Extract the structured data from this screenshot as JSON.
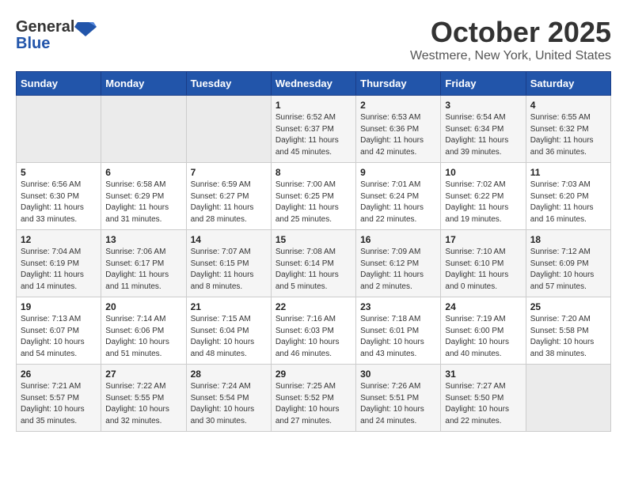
{
  "header": {
    "logo_line1": "General",
    "logo_line2": "Blue",
    "month": "October 2025",
    "location": "Westmere, New York, United States"
  },
  "weekdays": [
    "Sunday",
    "Monday",
    "Tuesday",
    "Wednesday",
    "Thursday",
    "Friday",
    "Saturday"
  ],
  "weeks": [
    [
      {
        "day": "",
        "info": ""
      },
      {
        "day": "",
        "info": ""
      },
      {
        "day": "",
        "info": ""
      },
      {
        "day": "1",
        "info": "Sunrise: 6:52 AM\nSunset: 6:37 PM\nDaylight: 11 hours\nand 45 minutes."
      },
      {
        "day": "2",
        "info": "Sunrise: 6:53 AM\nSunset: 6:36 PM\nDaylight: 11 hours\nand 42 minutes."
      },
      {
        "day": "3",
        "info": "Sunrise: 6:54 AM\nSunset: 6:34 PM\nDaylight: 11 hours\nand 39 minutes."
      },
      {
        "day": "4",
        "info": "Sunrise: 6:55 AM\nSunset: 6:32 PM\nDaylight: 11 hours\nand 36 minutes."
      }
    ],
    [
      {
        "day": "5",
        "info": "Sunrise: 6:56 AM\nSunset: 6:30 PM\nDaylight: 11 hours\nand 33 minutes."
      },
      {
        "day": "6",
        "info": "Sunrise: 6:58 AM\nSunset: 6:29 PM\nDaylight: 11 hours\nand 31 minutes."
      },
      {
        "day": "7",
        "info": "Sunrise: 6:59 AM\nSunset: 6:27 PM\nDaylight: 11 hours\nand 28 minutes."
      },
      {
        "day": "8",
        "info": "Sunrise: 7:00 AM\nSunset: 6:25 PM\nDaylight: 11 hours\nand 25 minutes."
      },
      {
        "day": "9",
        "info": "Sunrise: 7:01 AM\nSunset: 6:24 PM\nDaylight: 11 hours\nand 22 minutes."
      },
      {
        "day": "10",
        "info": "Sunrise: 7:02 AM\nSunset: 6:22 PM\nDaylight: 11 hours\nand 19 minutes."
      },
      {
        "day": "11",
        "info": "Sunrise: 7:03 AM\nSunset: 6:20 PM\nDaylight: 11 hours\nand 16 minutes."
      }
    ],
    [
      {
        "day": "12",
        "info": "Sunrise: 7:04 AM\nSunset: 6:19 PM\nDaylight: 11 hours\nand 14 minutes."
      },
      {
        "day": "13",
        "info": "Sunrise: 7:06 AM\nSunset: 6:17 PM\nDaylight: 11 hours\nand 11 minutes."
      },
      {
        "day": "14",
        "info": "Sunrise: 7:07 AM\nSunset: 6:15 PM\nDaylight: 11 hours\nand 8 minutes."
      },
      {
        "day": "15",
        "info": "Sunrise: 7:08 AM\nSunset: 6:14 PM\nDaylight: 11 hours\nand 5 minutes."
      },
      {
        "day": "16",
        "info": "Sunrise: 7:09 AM\nSunset: 6:12 PM\nDaylight: 11 hours\nand 2 minutes."
      },
      {
        "day": "17",
        "info": "Sunrise: 7:10 AM\nSunset: 6:10 PM\nDaylight: 11 hours\nand 0 minutes."
      },
      {
        "day": "18",
        "info": "Sunrise: 7:12 AM\nSunset: 6:09 PM\nDaylight: 10 hours\nand 57 minutes."
      }
    ],
    [
      {
        "day": "19",
        "info": "Sunrise: 7:13 AM\nSunset: 6:07 PM\nDaylight: 10 hours\nand 54 minutes."
      },
      {
        "day": "20",
        "info": "Sunrise: 7:14 AM\nSunset: 6:06 PM\nDaylight: 10 hours\nand 51 minutes."
      },
      {
        "day": "21",
        "info": "Sunrise: 7:15 AM\nSunset: 6:04 PM\nDaylight: 10 hours\nand 48 minutes."
      },
      {
        "day": "22",
        "info": "Sunrise: 7:16 AM\nSunset: 6:03 PM\nDaylight: 10 hours\nand 46 minutes."
      },
      {
        "day": "23",
        "info": "Sunrise: 7:18 AM\nSunset: 6:01 PM\nDaylight: 10 hours\nand 43 minutes."
      },
      {
        "day": "24",
        "info": "Sunrise: 7:19 AM\nSunset: 6:00 PM\nDaylight: 10 hours\nand 40 minutes."
      },
      {
        "day": "25",
        "info": "Sunrise: 7:20 AM\nSunset: 5:58 PM\nDaylight: 10 hours\nand 38 minutes."
      }
    ],
    [
      {
        "day": "26",
        "info": "Sunrise: 7:21 AM\nSunset: 5:57 PM\nDaylight: 10 hours\nand 35 minutes."
      },
      {
        "day": "27",
        "info": "Sunrise: 7:22 AM\nSunset: 5:55 PM\nDaylight: 10 hours\nand 32 minutes."
      },
      {
        "day": "28",
        "info": "Sunrise: 7:24 AM\nSunset: 5:54 PM\nDaylight: 10 hours\nand 30 minutes."
      },
      {
        "day": "29",
        "info": "Sunrise: 7:25 AM\nSunset: 5:52 PM\nDaylight: 10 hours\nand 27 minutes."
      },
      {
        "day": "30",
        "info": "Sunrise: 7:26 AM\nSunset: 5:51 PM\nDaylight: 10 hours\nand 24 minutes."
      },
      {
        "day": "31",
        "info": "Sunrise: 7:27 AM\nSunset: 5:50 PM\nDaylight: 10 hours\nand 22 minutes."
      },
      {
        "day": "",
        "info": ""
      }
    ]
  ]
}
